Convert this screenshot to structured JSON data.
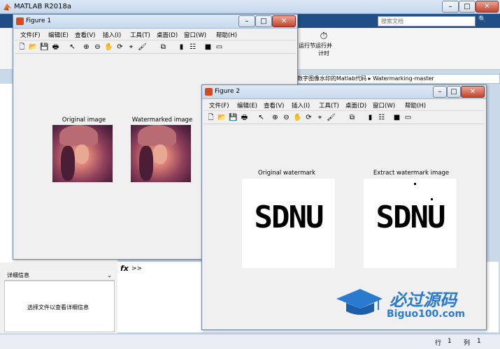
{
  "app": {
    "title": "MATLAB R2018a",
    "search_placeholder": "搜索文档"
  },
  "ribbon": {
    "item1": "运行节",
    "item2": "运行并\n计时",
    "item3": "进"
  },
  "address": {
    "path": "数字图像水印的Matlab代码 ▸ Watermarking-master"
  },
  "detail": {
    "header": "详细信息",
    "body": "选择文件以查看详细信息"
  },
  "cmd": {
    "prompt": ">>",
    "fx": "fx"
  },
  "status": {
    "row_label": "行",
    "row": "1",
    "col_label": "列",
    "col": "1"
  },
  "watermark_brand": {
    "cn": "必过源码",
    "url": "Biguo100.com"
  },
  "fig1": {
    "title": "Figure 1",
    "menu": [
      "文件(F)",
      "编辑(E)",
      "查看(V)",
      "插入(I)",
      "工具(T)",
      "桌面(D)",
      "窗口(W)",
      "帮助(H)"
    ],
    "axes": [
      {
        "title": "Original image"
      },
      {
        "title": "Watermarked image"
      }
    ]
  },
  "fig2": {
    "title": "Figure 2",
    "menu": [
      "文件(F)",
      "编辑(E)",
      "查看(V)",
      "插入(I)",
      "工具(T)",
      "桌面(D)",
      "窗口(W)",
      "帮助(H)"
    ],
    "axes": [
      {
        "title": "Original watermark",
        "text": "SDNU"
      },
      {
        "title": "Extract watermark image",
        "text": "SDNU"
      }
    ]
  },
  "colors": {
    "accent": "#1f4f86",
    "close": "#c4442c",
    "brand_blue": "#2a7bd0"
  }
}
